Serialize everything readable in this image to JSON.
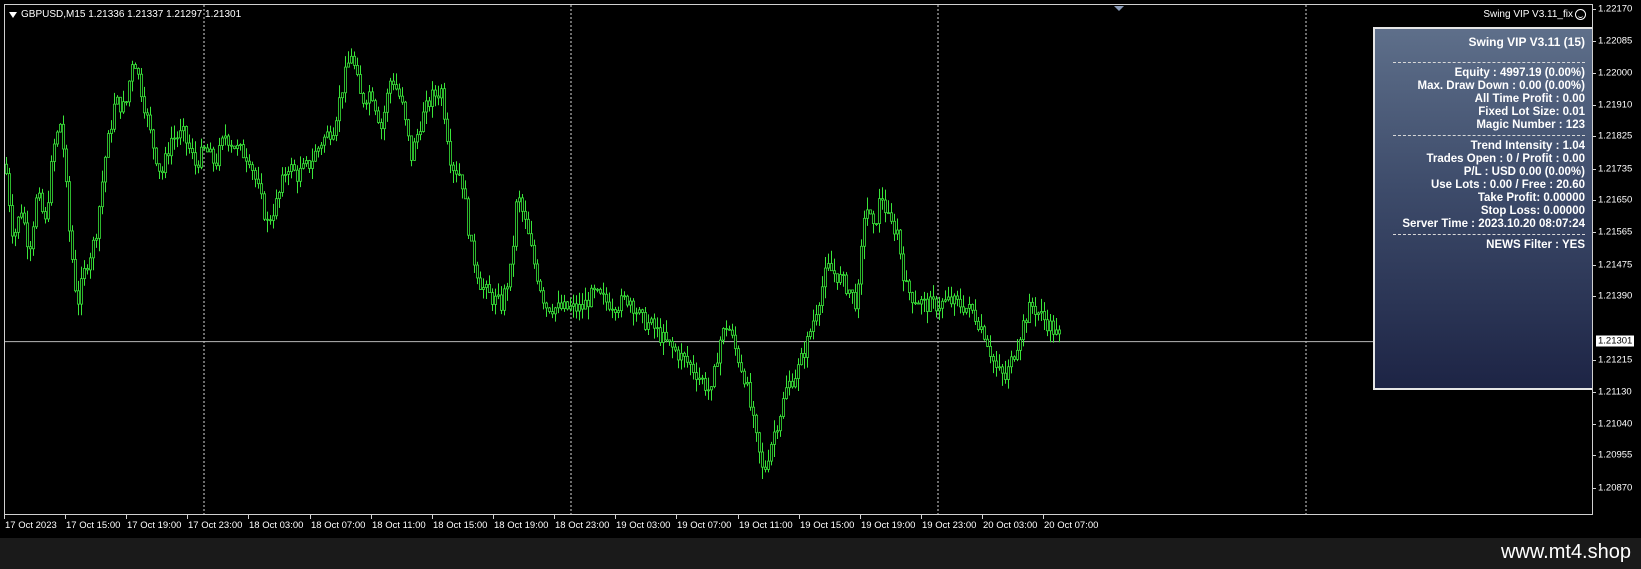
{
  "symbol_info": "GBPUSD,M15  1.21336 1.21337 1.21297 1.21301",
  "ea_name": "Swing VIP V3.11_fix",
  "panel": {
    "title": "Swing VIP V3.11 (15)",
    "group1": [
      "Equity : 4997.19 (0.00%)",
      "Max. Draw Down : 0.00 (0.00%)",
      "All Time Profit : 0.00",
      "Fixed Lot Size: 0.01",
      "Magic Number : 123"
    ],
    "group2": [
      "Trend Intensity : 1.04",
      "Trades Open : 0 / Profit : 0.00",
      "P/L : USD 0.00 (0.00%)",
      "Use Lots : 0.00 / Free : 20.60",
      "Take Profit: 0.00000",
      "Stop Loss: 0.00000",
      "Server Time : 2023.10.20 08:07:24"
    ],
    "group3": [
      "NEWS Filter : YES"
    ]
  },
  "price_axis": [
    "1.22170",
    "1.22085",
    "1.22000",
    "1.21910",
    "1.21825",
    "1.21735",
    "1.21650",
    "1.21565",
    "1.21475",
    "1.21390",
    "1.21215",
    "1.21130",
    "1.21040",
    "1.20955",
    "1.20870"
  ],
  "current_price": "1.21301",
  "time_axis": [
    "17 Oct 2023",
    "17 Oct 15:00",
    "17 Oct 19:00",
    "17 Oct 23:00",
    "18 Oct 03:00",
    "18 Oct 07:00",
    "18 Oct 11:00",
    "18 Oct 15:00",
    "18 Oct 19:00",
    "18 Oct 23:00",
    "19 Oct 03:00",
    "19 Oct 07:00",
    "19 Oct 11:00",
    "19 Oct 15:00",
    "19 Oct 19:00",
    "19 Oct 23:00",
    "20 Oct 03:00",
    "20 Oct 07:00"
  ],
  "watermark": "www.mt4.shop",
  "colors": {
    "candle": "#39e639",
    "background": "#000000",
    "grid": "#c8c8c8",
    "panel_top": "#5e6f8a",
    "panel_bottom": "#1d2445"
  },
  "chart_data": {
    "type": "candlestick",
    "symbol": "GBPUSD",
    "timeframe": "M15",
    "ylim": [
      1.2083,
      1.2221
    ],
    "current_price": 1.21301,
    "close_path": [
      [
        0,
        1.2178
      ],
      [
        8,
        1.2158
      ],
      [
        16,
        1.2166
      ],
      [
        24,
        1.2155
      ],
      [
        32,
        1.217
      ],
      [
        40,
        1.2162
      ],
      [
        48,
        1.2182
      ],
      [
        56,
        1.219
      ],
      [
        64,
        1.216
      ],
      [
        72,
        1.214
      ],
      [
        80,
        1.215
      ],
      [
        90,
        1.2158
      ],
      [
        100,
        1.218
      ],
      [
        110,
        1.2195
      ],
      [
        120,
        1.2193
      ],
      [
        128,
        1.2208
      ],
      [
        136,
        1.2198
      ],
      [
        146,
        1.2185
      ],
      [
        156,
        1.2175
      ],
      [
        166,
        1.2185
      ],
      [
        178,
        1.2186
      ],
      [
        190,
        1.2178
      ],
      [
        200,
        1.2182
      ],
      [
        210,
        1.2178
      ],
      [
        220,
        1.2186
      ],
      [
        232,
        1.2182
      ],
      [
        244,
        1.218
      ],
      [
        254,
        1.217
      ],
      [
        262,
        1.2162
      ],
      [
        272,
        1.2168
      ],
      [
        282,
        1.2178
      ],
      [
        292,
        1.2175
      ],
      [
        304,
        1.2178
      ],
      [
        316,
        1.2184
      ],
      [
        328,
        1.2188
      ],
      [
        338,
        1.22
      ],
      [
        346,
        1.2208
      ],
      [
        356,
        1.2195
      ],
      [
        366,
        1.2198
      ],
      [
        376,
        1.2188
      ],
      [
        386,
        1.2202
      ],
      [
        396,
        1.2195
      ],
      [
        406,
        1.218
      ],
      [
        416,
        1.219
      ],
      [
        426,
        1.2196
      ],
      [
        436,
        1.2198
      ],
      [
        446,
        1.2178
      ],
      [
        456,
        1.2175
      ],
      [
        466,
        1.2155
      ],
      [
        476,
        1.2145
      ],
      [
        486,
        1.2142
      ],
      [
        496,
        1.214
      ],
      [
        506,
        1.215
      ],
      [
        512,
        1.217
      ],
      [
        520,
        1.2162
      ],
      [
        530,
        1.215
      ],
      [
        540,
        1.214
      ],
      [
        552,
        1.2139
      ],
      [
        564,
        1.2139
      ],
      [
        576,
        1.2139
      ],
      [
        588,
        1.2143
      ],
      [
        600,
        1.2141
      ],
      [
        612,
        1.214
      ],
      [
        624,
        1.2142
      ],
      [
        636,
        1.2136
      ],
      [
        648,
        1.2134
      ],
      [
        660,
        1.213
      ],
      [
        672,
        1.2127
      ],
      [
        684,
        1.2124
      ],
      [
        696,
        1.212
      ],
      [
        706,
        1.2116
      ],
      [
        714,
        1.213
      ],
      [
        722,
        1.2135
      ],
      [
        730,
        1.2128
      ],
      [
        740,
        1.212
      ],
      [
        750,
        1.2105
      ],
      [
        758,
        1.2094
      ],
      [
        766,
        1.2103
      ],
      [
        774,
        1.211
      ],
      [
        782,
        1.2118
      ],
      [
        792,
        1.2122
      ],
      [
        802,
        1.213
      ],
      [
        812,
        1.214
      ],
      [
        822,
        1.215
      ],
      [
        832,
        1.2148
      ],
      [
        844,
        1.2144
      ],
      [
        852,
        1.214
      ],
      [
        860,
        1.2168
      ],
      [
        868,
        1.216
      ],
      [
        876,
        1.217
      ],
      [
        884,
        1.2162
      ],
      [
        892,
        1.216
      ],
      [
        900,
        1.2145
      ],
      [
        908,
        1.2142
      ],
      [
        920,
        1.214
      ],
      [
        932,
        1.214
      ],
      [
        944,
        1.2141
      ],
      [
        956,
        1.214
      ],
      [
        968,
        1.2138
      ],
      [
        980,
        1.2132
      ],
      [
        990,
        1.2123
      ],
      [
        1000,
        1.212
      ],
      [
        1010,
        1.2128
      ],
      [
        1018,
        1.2135
      ],
      [
        1026,
        1.214
      ],
      [
        1036,
        1.2137
      ],
      [
        1046,
        1.2134
      ],
      [
        1056,
        1.213
      ]
    ]
  }
}
